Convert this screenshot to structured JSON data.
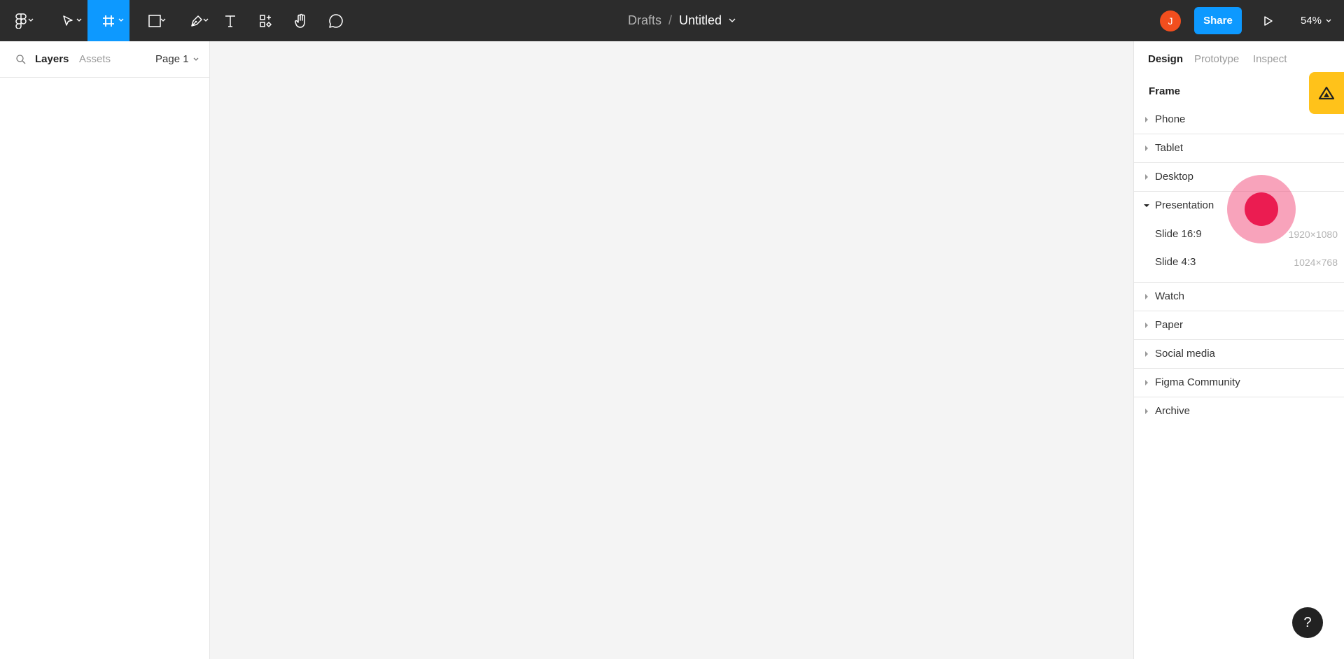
{
  "toolbar": {
    "breadcrumb_parent": "Drafts",
    "breadcrumb_separator": "/",
    "file_title": "Untitled",
    "avatar_initial": "J",
    "share_label": "Share",
    "zoom_level": "54%",
    "active_tool": "frame-tool",
    "accent_color": "#0d99ff"
  },
  "left_panel": {
    "tab_layers": "Layers",
    "tab_assets": "Assets",
    "page_label": "Page 1"
  },
  "right_panel": {
    "tabs": [
      "Design",
      "Prototype",
      "Inspect"
    ],
    "section_title": "Frame",
    "categories": [
      {
        "label": "Phone",
        "expanded": false
      },
      {
        "label": "Tablet",
        "expanded": false
      },
      {
        "label": "Desktop",
        "expanded": false
      },
      {
        "label": "Presentation",
        "expanded": true,
        "items": [
          {
            "label": "Slide 16:9",
            "size": "1920×1080"
          },
          {
            "label": "Slide 4:3",
            "size": "1024×768"
          }
        ]
      },
      {
        "label": "Watch",
        "expanded": false
      },
      {
        "label": "Paper",
        "expanded": false
      },
      {
        "label": "Social media",
        "expanded": false
      },
      {
        "label": "Figma Community",
        "expanded": false
      },
      {
        "label": "Archive",
        "expanded": false
      }
    ]
  },
  "help_label": "?"
}
